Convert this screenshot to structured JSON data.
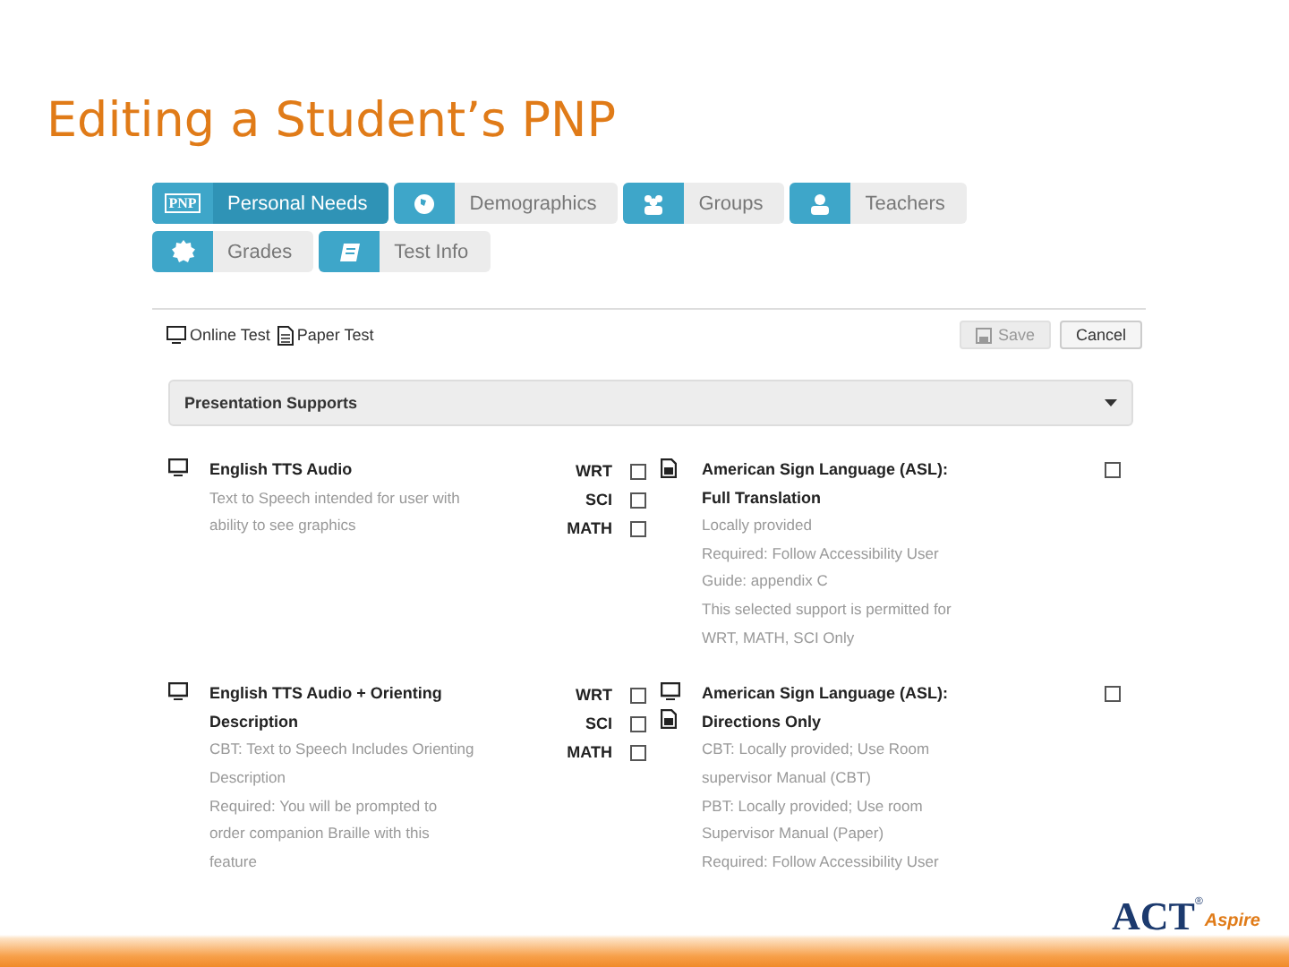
{
  "slide_title": "Editing a Student’s PNP",
  "tabs": [
    {
      "label": "Personal Needs",
      "kind": "pnp",
      "icon_text": "PNP",
      "selected": true
    },
    {
      "label": "Demographics",
      "kind": "globe",
      "selected": false
    },
    {
      "label": "Groups",
      "kind": "group",
      "selected": false
    },
    {
      "label": "Teachers",
      "kind": "person",
      "selected": false
    },
    {
      "label": "Grades",
      "kind": "badge",
      "selected": false
    },
    {
      "label": "Test Info",
      "kind": "book",
      "selected": false
    }
  ],
  "legend": [
    {
      "kind": "online",
      "label": "Online Test"
    },
    {
      "kind": "paper",
      "label": "Paper Test"
    }
  ],
  "buttons": [
    {
      "label": "Save",
      "kind": "save",
      "disabled": true
    },
    {
      "label": "Cancel",
      "kind": "cancel",
      "disabled": false
    }
  ],
  "section": {
    "title": "Presentation Supports",
    "expanded": true
  },
  "supports": [
    {
      "online_test": true,
      "paper_test": false,
      "title": "English TTS Audio",
      "lines": [
        "Text to Speech intended for user with",
        "ability to see graphics"
      ],
      "subjects": [
        {
          "label": "WRT",
          "checked": false
        },
        {
          "label": "SCI",
          "checked": false
        },
        {
          "label": "MATH",
          "checked": false
        }
      ]
    },
    {
      "online_test": false,
      "paper_test": true,
      "title": "American Sign Language (ASL): Full Translation",
      "lines": [
        "Locally provided",
        "Required: Follow Accessibility User",
        "Guide: appendix C",
        "This selected support is permitted for",
        "WRT, MATH, SCI Only"
      ],
      "checked": false
    },
    {
      "online_test": true,
      "paper_test": false,
      "title": "English TTS Audio + Orienting Description",
      "lines": [
        "CBT: Text to Speech Includes Orienting",
        "Description",
        "Required: You will be prompted to",
        "order companion Braille with this",
        "feature"
      ],
      "subjects": [
        {
          "label": "WRT",
          "checked": false
        },
        {
          "label": "SCI",
          "checked": false
        },
        {
          "label": "MATH",
          "checked": false
        }
      ]
    },
    {
      "online_test": true,
      "paper_test": true,
      "title": "American Sign Language (ASL): Directions Only",
      "lines": [
        "CBT: Locally provided; Use Room",
        "supervisor Manual (CBT)",
        "PBT: Locally provided; Use room",
        "Supervisor Manual (Paper)",
        "Required: Follow Accessibility User"
      ],
      "checked": false
    }
  ],
  "logo": {
    "main": "ACT",
    "mark": "®",
    "sub": "Aspire"
  }
}
